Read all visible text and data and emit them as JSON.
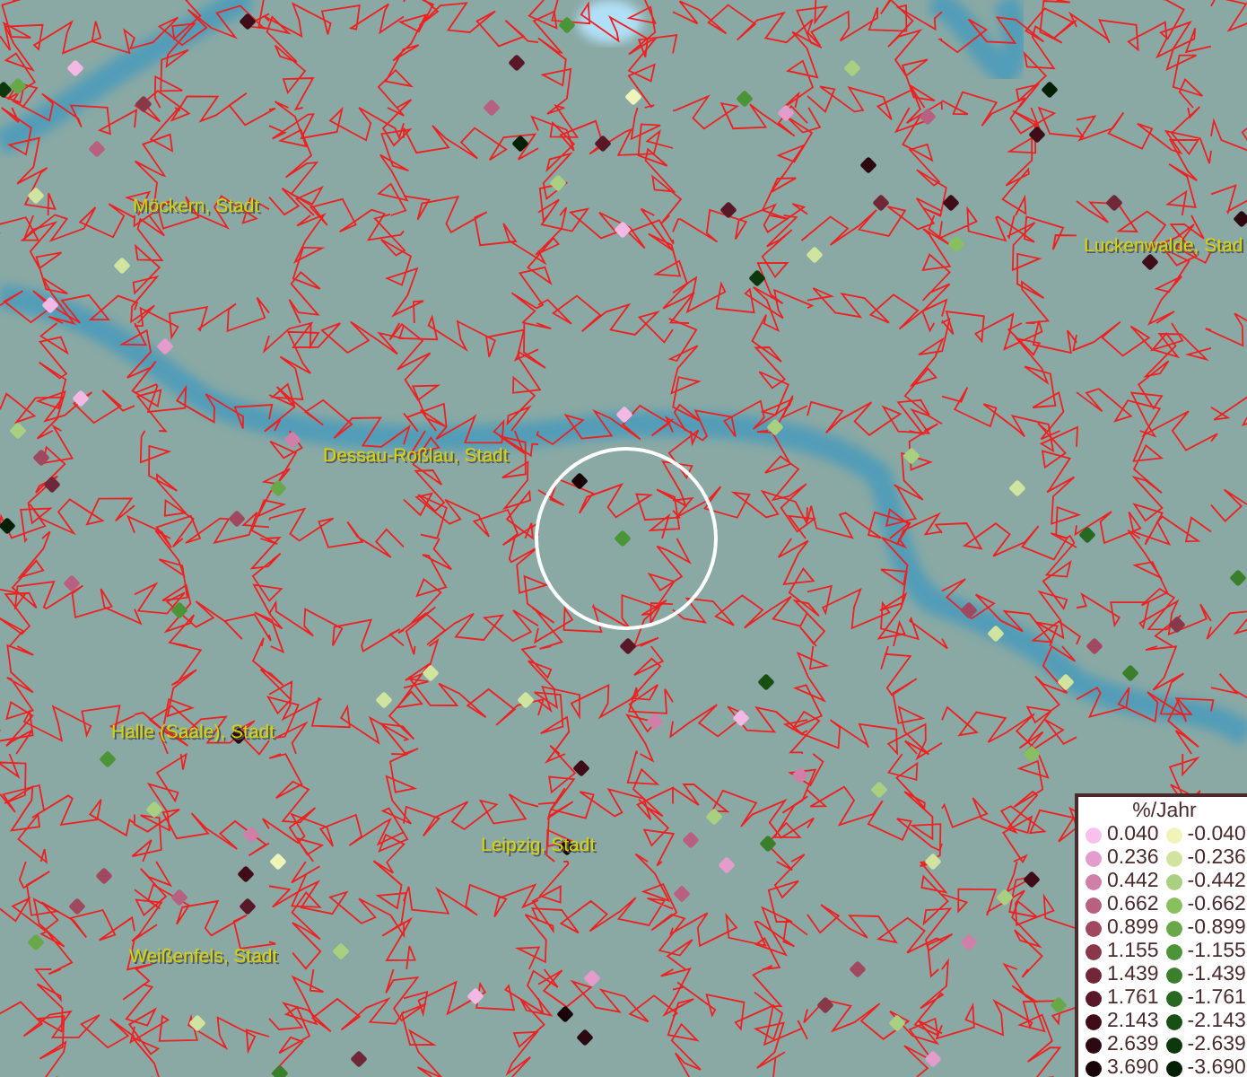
{
  "map": {
    "places": [
      {
        "label": "Möckern, Stadt"
      },
      {
        "label": "Luckenwalde, Stad"
      },
      {
        "label": "Dessau-Roßlau, Stadt"
      },
      {
        "label": "Halle (Saale), Stadt"
      },
      {
        "label": "Leipzig, Stadt"
      },
      {
        "label": "Weißenfels, Stadt"
      }
    ],
    "points": [
      {
        "color": "#400c18"
      },
      {
        "color": "#68a848"
      },
      {
        "color": "#f4b8e4"
      },
      {
        "color": "#883848"
      },
      {
        "color": "#b86080"
      },
      {
        "color": "#d0e4a0"
      },
      {
        "color": "#0c380c"
      },
      {
        "color": "#f0f4b8"
      },
      {
        "color": "#4c9438"
      },
      {
        "color": "#581828"
      },
      {
        "color": "#b86080"
      },
      {
        "color": "#042004"
      },
      {
        "color": "#581828"
      },
      {
        "color": "#a8d080"
      },
      {
        "color": "#f4b8e4"
      },
      {
        "color": "#e49ccc"
      },
      {
        "color": "#4c9438"
      },
      {
        "color": "#a8d080"
      },
      {
        "color": "#b86080"
      },
      {
        "color": "#400c18"
      },
      {
        "color": "#042004"
      },
      {
        "color": "#2c0810"
      },
      {
        "color": "#400c18"
      },
      {
        "color": "#581828"
      },
      {
        "color": "#0c380c"
      },
      {
        "color": "#d0e4a0"
      },
      {
        "color": "#702838"
      },
      {
        "color": "#2c0810"
      },
      {
        "color": "#400c18"
      },
      {
        "color": "#88c060"
      },
      {
        "color": "#702838"
      },
      {
        "color": "#d0e4a0"
      },
      {
        "color": "#f4b8e4"
      },
      {
        "color": "#e49ccc"
      },
      {
        "color": "#f4b8e4"
      },
      {
        "color": "#a04860"
      },
      {
        "color": "#a8d080"
      },
      {
        "color": "#042004"
      },
      {
        "color": "#702838"
      },
      {
        "color": "#d080a8"
      },
      {
        "color": "#68a848"
      },
      {
        "color": "#f4b8e4"
      },
      {
        "color": "#a8d080"
      },
      {
        "color": "#180408"
      },
      {
        "color": "#4c9438"
      },
      {
        "color": "#a8d080"
      },
      {
        "color": "#d0e4a0"
      },
      {
        "color": "#286820"
      },
      {
        "color": "#3a802c"
      },
      {
        "color": "#883848"
      },
      {
        "color": "#a04860"
      },
      {
        "color": "#d0e4a0"
      },
      {
        "color": "#a04860"
      },
      {
        "color": "#3a802c"
      },
      {
        "color": "#d0e4a0"
      },
      {
        "color": "#a04860"
      },
      {
        "color": "#4c9438"
      },
      {
        "color": "#b86080"
      },
      {
        "color": "#2c0810"
      },
      {
        "color": "#4c9438"
      },
      {
        "color": "#a8d080"
      },
      {
        "color": "#d080a8"
      },
      {
        "color": "#400c18"
      },
      {
        "color": "#f0f4b8"
      },
      {
        "color": "#a04860"
      },
      {
        "color": "#a04860"
      },
      {
        "color": "#68a848"
      },
      {
        "color": "#b86080"
      },
      {
        "color": "#581828"
      },
      {
        "color": "#d0e4a0"
      },
      {
        "color": "#d0e4a0"
      },
      {
        "color": "#d0e4a0"
      },
      {
        "color": "#581828"
      },
      {
        "color": "#400c18"
      },
      {
        "color": "#180408"
      },
      {
        "color": "#b86080"
      },
      {
        "color": "#a8d080"
      },
      {
        "color": "#d080a8"
      },
      {
        "color": "#f4b8e4"
      },
      {
        "color": "#185014"
      },
      {
        "color": "#3a802c"
      },
      {
        "color": "#b86080"
      },
      {
        "color": "#e49ccc"
      },
      {
        "color": "#e49ccc"
      },
      {
        "color": "#2c0810"
      },
      {
        "color": "#180408"
      },
      {
        "color": "#f4b8e4"
      },
      {
        "color": "#a8d080"
      },
      {
        "color": "#3a802c"
      },
      {
        "color": "#d0e4a0"
      },
      {
        "color": "#702838"
      },
      {
        "color": "#d080a8"
      },
      {
        "color": "#a8d080"
      },
      {
        "color": "#d0e4a0"
      },
      {
        "color": "#a8d080"
      },
      {
        "color": "#d080a8"
      },
      {
        "color": "#68a848"
      },
      {
        "color": "#400c18"
      },
      {
        "color": "#a04860"
      },
      {
        "color": "#883848"
      },
      {
        "color": "#a8d080"
      },
      {
        "color": "#e49ccc"
      },
      {
        "color": "#88c060"
      }
    ]
  },
  "legend": {
    "title": "%/Jahr",
    "columns": [
      [
        {
          "label": "0.040",
          "color": "#f8c0ec"
        },
        {
          "label": "0.236",
          "color": "#e49ccc"
        },
        {
          "label": "0.442",
          "color": "#d080a8"
        },
        {
          "label": "0.662",
          "color": "#b86080"
        },
        {
          "label": "0.899",
          "color": "#a04860"
        },
        {
          "label": "1.155",
          "color": "#883848"
        },
        {
          "label": "1.439",
          "color": "#702838"
        },
        {
          "label": "1.761",
          "color": "#581828"
        },
        {
          "label": "2.143",
          "color": "#400c18"
        },
        {
          "label": "2.639",
          "color": "#2c0810"
        },
        {
          "label": "3.690",
          "color": "#180408"
        }
      ],
      [
        {
          "label": "-0.040",
          "color": "#f0f4b8"
        },
        {
          "label": "-0.236",
          "color": "#d0e4a0"
        },
        {
          "label": "-0.442",
          "color": "#a8d080"
        },
        {
          "label": "-0.662",
          "color": "#88c060"
        },
        {
          "label": "-0.899",
          "color": "#68a848"
        },
        {
          "label": "-1.155",
          "color": "#4c9438"
        },
        {
          "label": "-1.439",
          "color": "#3a802c"
        },
        {
          "label": "-1.761",
          "color": "#286820"
        },
        {
          "label": "-2.143",
          "color": "#185014"
        },
        {
          "label": "-2.639",
          "color": "#0c380c"
        },
        {
          "label": "-3.690",
          "color": "#042004"
        }
      ]
    ]
  }
}
